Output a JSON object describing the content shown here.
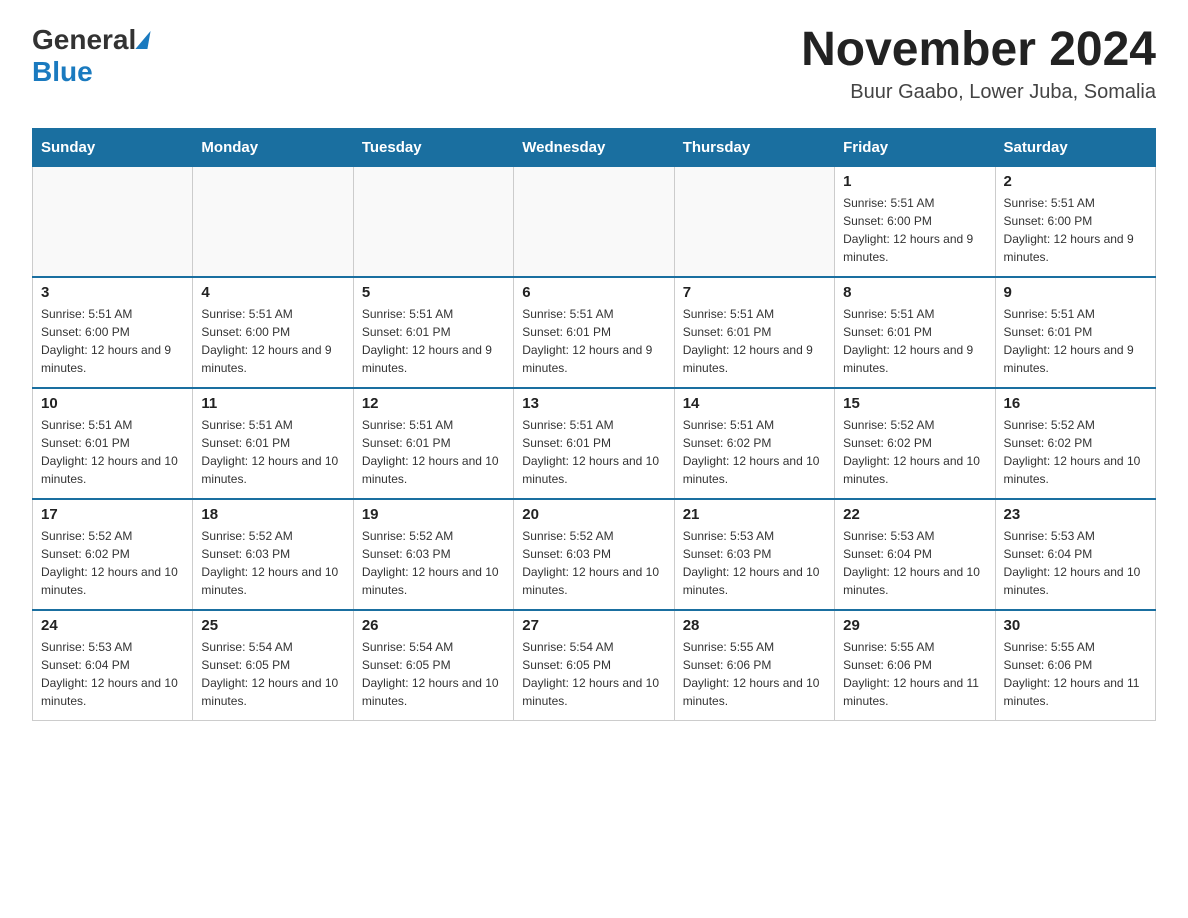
{
  "header": {
    "logo": {
      "general": "General",
      "blue": "Blue"
    },
    "title": "November 2024",
    "location": "Buur Gaabo, Lower Juba, Somalia"
  },
  "calendar": {
    "days_of_week": [
      "Sunday",
      "Monday",
      "Tuesday",
      "Wednesday",
      "Thursday",
      "Friday",
      "Saturday"
    ],
    "weeks": [
      {
        "days": [
          {
            "number": "",
            "info": ""
          },
          {
            "number": "",
            "info": ""
          },
          {
            "number": "",
            "info": ""
          },
          {
            "number": "",
            "info": ""
          },
          {
            "number": "",
            "info": ""
          },
          {
            "number": "1",
            "info": "Sunrise: 5:51 AM\nSunset: 6:00 PM\nDaylight: 12 hours and 9 minutes."
          },
          {
            "number": "2",
            "info": "Sunrise: 5:51 AM\nSunset: 6:00 PM\nDaylight: 12 hours and 9 minutes."
          }
        ]
      },
      {
        "days": [
          {
            "number": "3",
            "info": "Sunrise: 5:51 AM\nSunset: 6:00 PM\nDaylight: 12 hours and 9 minutes."
          },
          {
            "number": "4",
            "info": "Sunrise: 5:51 AM\nSunset: 6:00 PM\nDaylight: 12 hours and 9 minutes."
          },
          {
            "number": "5",
            "info": "Sunrise: 5:51 AM\nSunset: 6:01 PM\nDaylight: 12 hours and 9 minutes."
          },
          {
            "number": "6",
            "info": "Sunrise: 5:51 AM\nSunset: 6:01 PM\nDaylight: 12 hours and 9 minutes."
          },
          {
            "number": "7",
            "info": "Sunrise: 5:51 AM\nSunset: 6:01 PM\nDaylight: 12 hours and 9 minutes."
          },
          {
            "number": "8",
            "info": "Sunrise: 5:51 AM\nSunset: 6:01 PM\nDaylight: 12 hours and 9 minutes."
          },
          {
            "number": "9",
            "info": "Sunrise: 5:51 AM\nSunset: 6:01 PM\nDaylight: 12 hours and 9 minutes."
          }
        ]
      },
      {
        "days": [
          {
            "number": "10",
            "info": "Sunrise: 5:51 AM\nSunset: 6:01 PM\nDaylight: 12 hours and 10 minutes."
          },
          {
            "number": "11",
            "info": "Sunrise: 5:51 AM\nSunset: 6:01 PM\nDaylight: 12 hours and 10 minutes."
          },
          {
            "number": "12",
            "info": "Sunrise: 5:51 AM\nSunset: 6:01 PM\nDaylight: 12 hours and 10 minutes."
          },
          {
            "number": "13",
            "info": "Sunrise: 5:51 AM\nSunset: 6:01 PM\nDaylight: 12 hours and 10 minutes."
          },
          {
            "number": "14",
            "info": "Sunrise: 5:51 AM\nSunset: 6:02 PM\nDaylight: 12 hours and 10 minutes."
          },
          {
            "number": "15",
            "info": "Sunrise: 5:52 AM\nSunset: 6:02 PM\nDaylight: 12 hours and 10 minutes."
          },
          {
            "number": "16",
            "info": "Sunrise: 5:52 AM\nSunset: 6:02 PM\nDaylight: 12 hours and 10 minutes."
          }
        ]
      },
      {
        "days": [
          {
            "number": "17",
            "info": "Sunrise: 5:52 AM\nSunset: 6:02 PM\nDaylight: 12 hours and 10 minutes."
          },
          {
            "number": "18",
            "info": "Sunrise: 5:52 AM\nSunset: 6:03 PM\nDaylight: 12 hours and 10 minutes."
          },
          {
            "number": "19",
            "info": "Sunrise: 5:52 AM\nSunset: 6:03 PM\nDaylight: 12 hours and 10 minutes."
          },
          {
            "number": "20",
            "info": "Sunrise: 5:52 AM\nSunset: 6:03 PM\nDaylight: 12 hours and 10 minutes."
          },
          {
            "number": "21",
            "info": "Sunrise: 5:53 AM\nSunset: 6:03 PM\nDaylight: 12 hours and 10 minutes."
          },
          {
            "number": "22",
            "info": "Sunrise: 5:53 AM\nSunset: 6:04 PM\nDaylight: 12 hours and 10 minutes."
          },
          {
            "number": "23",
            "info": "Sunrise: 5:53 AM\nSunset: 6:04 PM\nDaylight: 12 hours and 10 minutes."
          }
        ]
      },
      {
        "days": [
          {
            "number": "24",
            "info": "Sunrise: 5:53 AM\nSunset: 6:04 PM\nDaylight: 12 hours and 10 minutes."
          },
          {
            "number": "25",
            "info": "Sunrise: 5:54 AM\nSunset: 6:05 PM\nDaylight: 12 hours and 10 minutes."
          },
          {
            "number": "26",
            "info": "Sunrise: 5:54 AM\nSunset: 6:05 PM\nDaylight: 12 hours and 10 minutes."
          },
          {
            "number": "27",
            "info": "Sunrise: 5:54 AM\nSunset: 6:05 PM\nDaylight: 12 hours and 10 minutes."
          },
          {
            "number": "28",
            "info": "Sunrise: 5:55 AM\nSunset: 6:06 PM\nDaylight: 12 hours and 10 minutes."
          },
          {
            "number": "29",
            "info": "Sunrise: 5:55 AM\nSunset: 6:06 PM\nDaylight: 12 hours and 11 minutes."
          },
          {
            "number": "30",
            "info": "Sunrise: 5:55 AM\nSunset: 6:06 PM\nDaylight: 12 hours and 11 minutes."
          }
        ]
      }
    ]
  }
}
